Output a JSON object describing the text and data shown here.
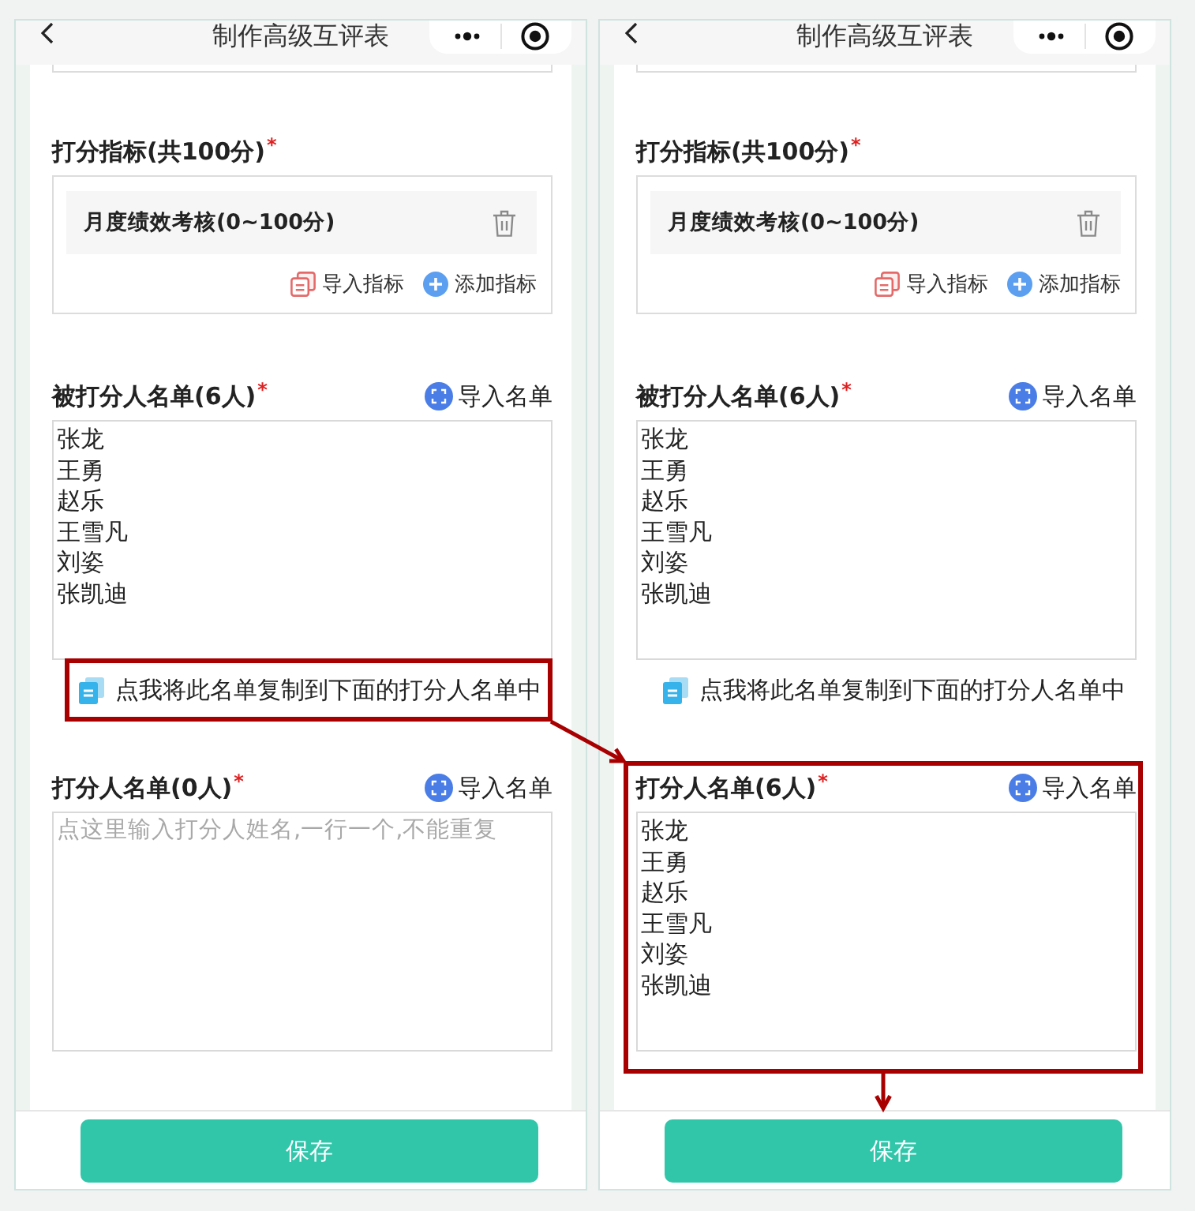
{
  "screens": [
    {
      "nav": {
        "title": "制作高级互评表"
      },
      "sections": [
        {
          "kind": "cut-field"
        },
        {
          "kind": "criteria",
          "label": "打分指标(共100分)",
          "required_mark": "*",
          "items": [
            {
              "name": "月度绩效考核(0~100分)"
            }
          ],
          "actions": [
            {
              "kind": "import",
              "label": "导入指标"
            },
            {
              "kind": "add",
              "label": "添加指标"
            }
          ]
        },
        {
          "kind": "list",
          "label": "被打分人名单(6人)",
          "required_mark": "*",
          "import_label": "导入名单",
          "lines": [
            "张龙",
            "王勇",
            "赵乐",
            "王雪凡",
            "刘姿",
            "张凯迪"
          ],
          "highlighted": false,
          "arrow_down": false,
          "copy_link": {
            "text": "点我将此名单复制到下面的打分人名单中",
            "highlighted": true,
            "arrow_to_next_screen": true
          }
        },
        {
          "kind": "list",
          "label": "打分人名单(0人)",
          "required_mark": "*",
          "import_label": "导入名单",
          "placeholder": "点这里输入打分人姓名,一行一个,不能重复",
          "highlighted": false,
          "arrow_down": false
        }
      ],
      "save_label": "保存"
    },
    {
      "nav": {
        "title": "制作高级互评表"
      },
      "sections": [
        {
          "kind": "cut-field"
        },
        {
          "kind": "criteria",
          "label": "打分指标(共100分)",
          "required_mark": "*",
          "items": [
            {
              "name": "月度绩效考核(0~100分)"
            }
          ],
          "actions": [
            {
              "kind": "import",
              "label": "导入指标"
            },
            {
              "kind": "add",
              "label": "添加指标"
            }
          ]
        },
        {
          "kind": "list",
          "label": "被打分人名单(6人)",
          "required_mark": "*",
          "import_label": "导入名单",
          "lines": [
            "张龙",
            "王勇",
            "赵乐",
            "王雪凡",
            "刘姿",
            "张凯迪"
          ],
          "highlighted": false,
          "arrow_down": false,
          "copy_link": {
            "text": "点我将此名单复制到下面的打分人名单中",
            "highlighted": false,
            "arrow_to_next_screen": false
          }
        },
        {
          "kind": "list",
          "label": "打分人名单(6人)",
          "required_mark": "*",
          "import_label": "导入名单",
          "lines": [
            "张龙",
            "王勇",
            "赵乐",
            "王雪凡",
            "刘姿",
            "张凯迪"
          ],
          "highlighted": true,
          "arrow_down": true
        }
      ],
      "save_label": "保存"
    }
  ]
}
